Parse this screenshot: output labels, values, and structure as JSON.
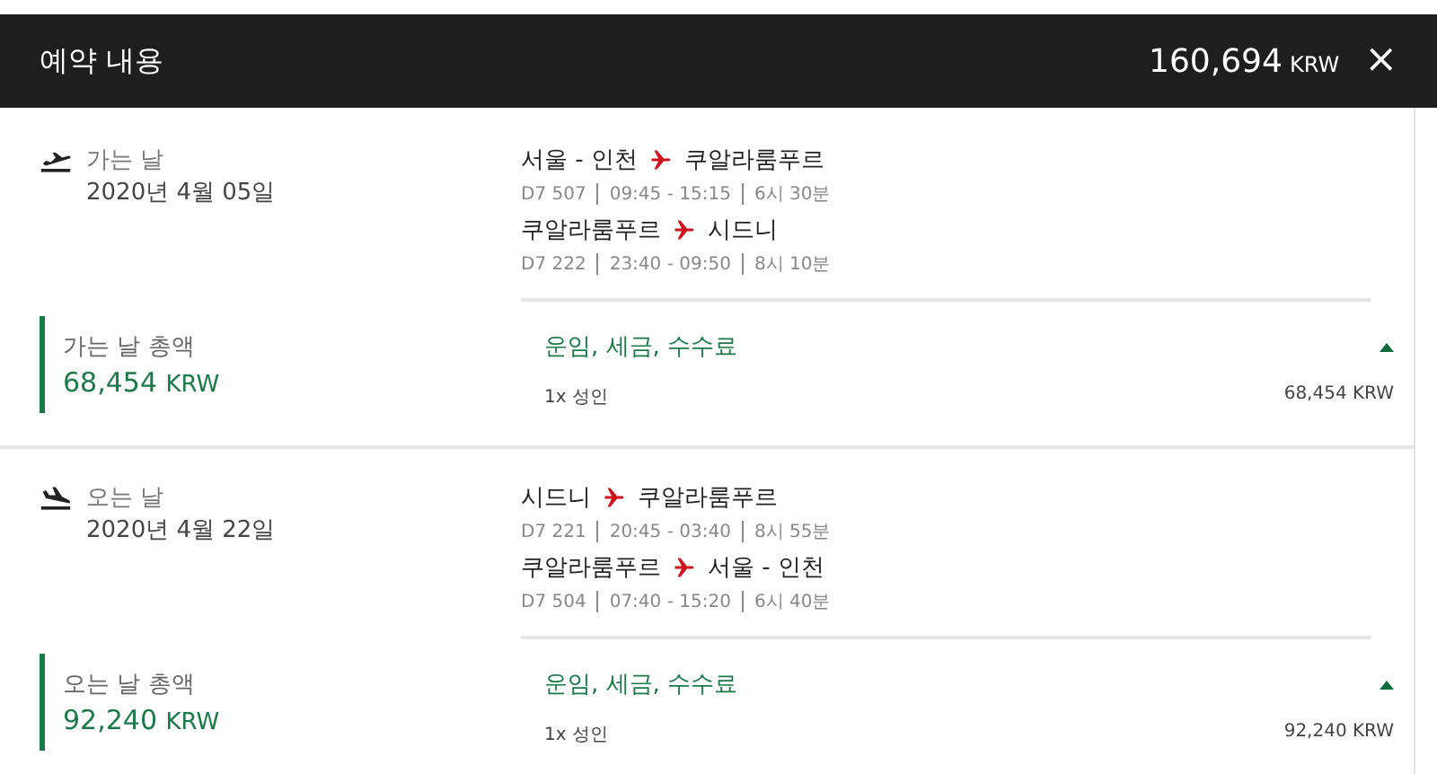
{
  "header": {
    "title": "예약 내용",
    "total": "160,694",
    "currency": "KRW",
    "close": "×"
  },
  "legs": [
    {
      "kind": "departure",
      "label": "가는 날",
      "date": "2020년 4월 05일",
      "segments": [
        {
          "from": "서울 - 인천",
          "to": "쿠알라룸푸르",
          "flight": "D7 507",
          "times": "09:45 - 15:15",
          "duration": "6시 30분"
        },
        {
          "from": "쿠알라룸푸르",
          "to": "시드니",
          "flight": "D7 222",
          "times": "23:40 - 09:50",
          "duration": "8시 10분"
        }
      ],
      "total_label": "가는 날 총액",
      "total": "68,454",
      "currency": "KRW",
      "fees": {
        "label": "운임, 세금, 수수료",
        "expanded": true,
        "passenger": "1x 성인",
        "amount": "68,454 KRW"
      }
    },
    {
      "kind": "return",
      "label": "오는 날",
      "date": "2020년 4월 22일",
      "segments": [
        {
          "from": "시드니",
          "to": "쿠알라룸푸르",
          "flight": "D7 221",
          "times": "20:45 - 03:40",
          "duration": "8시 55분"
        },
        {
          "from": "쿠알라룸푸르",
          "to": "서울 - 인천",
          "flight": "D7 504",
          "times": "07:40 - 15:20",
          "duration": "6시 40분"
        }
      ],
      "total_label": "오는 날 총액",
      "total": "92,240",
      "currency": "KRW",
      "fees": {
        "label": "운임, 세금, 수수료",
        "expanded": true,
        "passenger": "1x 성인",
        "amount": "92,240 KRW"
      }
    }
  ]
}
